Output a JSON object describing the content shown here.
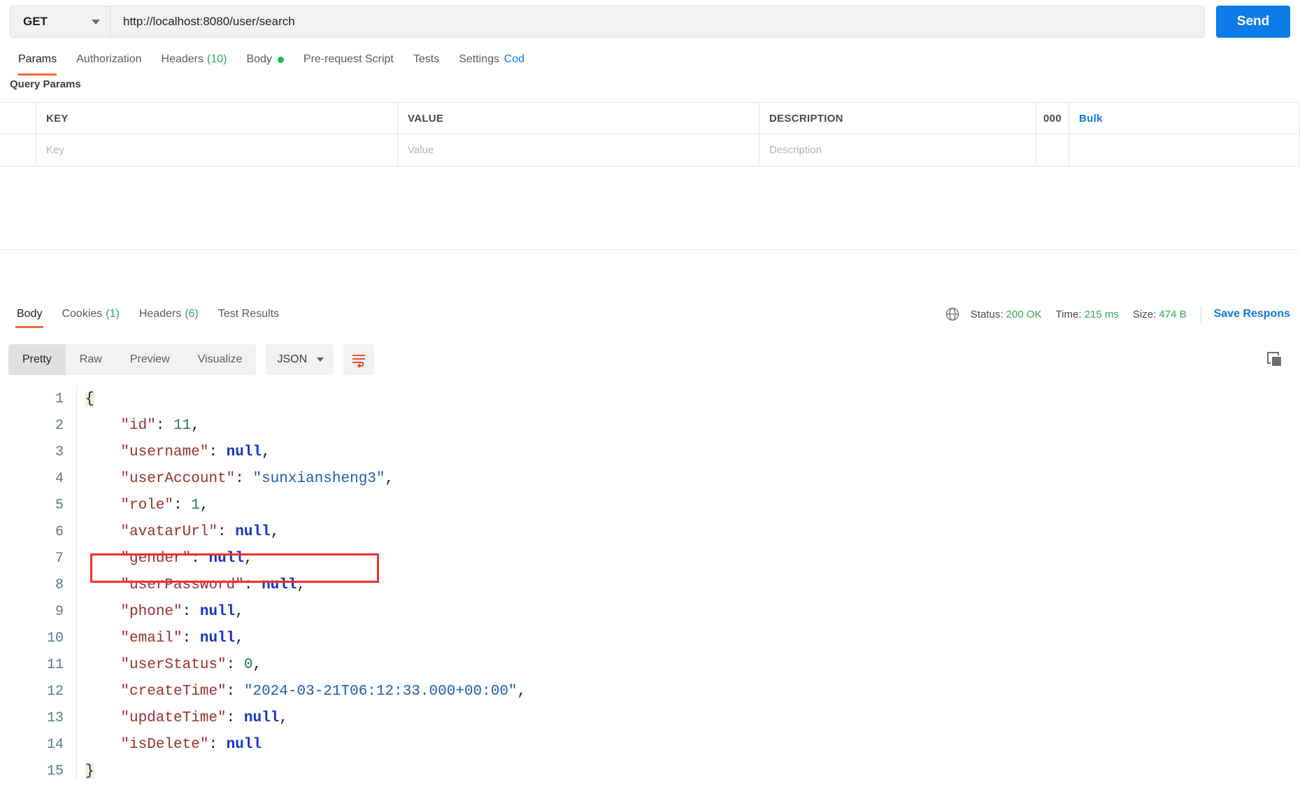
{
  "request": {
    "method": "GET",
    "url": "http://localhost:8080/user/search",
    "send_label": "Send",
    "tabs": [
      {
        "label": "Params",
        "count": "",
        "active": true
      },
      {
        "label": "Authorization",
        "count": "",
        "active": false
      },
      {
        "label": "Headers",
        "count": "(10)",
        "active": false
      },
      {
        "label": "Body",
        "count": "",
        "active": false,
        "dot": true
      },
      {
        "label": "Pre-request Script",
        "count": "",
        "active": false
      },
      {
        "label": "Tests",
        "count": "",
        "active": false
      },
      {
        "label": "Settings",
        "count": "",
        "active": false
      }
    ],
    "code_link": "Cod"
  },
  "params": {
    "section_title": "Query Params",
    "headers": {
      "key": "KEY",
      "value": "VALUE",
      "description": "DESCRIPTION",
      "more": "000",
      "bulk": "Bulk"
    },
    "rows": [
      {
        "key": "Key",
        "value": "Value",
        "description": "Description"
      }
    ]
  },
  "response": {
    "tabs": [
      {
        "label": "Body",
        "count": "",
        "active": true
      },
      {
        "label": "Cookies",
        "count": "(1)",
        "active": false
      },
      {
        "label": "Headers",
        "count": "(6)",
        "active": false
      },
      {
        "label": "Test Results",
        "count": "",
        "active": false
      }
    ],
    "status_label": "Status:",
    "status_value": "200 OK",
    "time_label": "Time:",
    "time_value": "215 ms",
    "size_label": "Size:",
    "size_value": "474 B",
    "save_response": "Save Respons",
    "view_modes": [
      {
        "label": "Pretty",
        "active": true
      },
      {
        "label": "Raw",
        "active": false
      },
      {
        "label": "Preview",
        "active": false
      },
      {
        "label": "Visualize",
        "active": false
      }
    ],
    "format": "JSON"
  },
  "colors": {
    "accent_orange": "#f26b3a",
    "brand_blue": "#0d7ce8",
    "status_green": "#2eab52",
    "highlight_red": "#f03030"
  },
  "body_json": {
    "line_numbers": [
      "1",
      "2",
      "3",
      "4",
      "5",
      "6",
      "7",
      "8",
      "9",
      "10",
      "11",
      "12",
      "13",
      "14",
      "15"
    ],
    "fields": [
      {
        "key": "id",
        "value": "11",
        "type": "number"
      },
      {
        "key": "username",
        "value": "null",
        "type": "null"
      },
      {
        "key": "userAccount",
        "value": "sunxiansheng3",
        "type": "string"
      },
      {
        "key": "role",
        "value": "1",
        "type": "number"
      },
      {
        "key": "avatarUrl",
        "value": "null",
        "type": "null"
      },
      {
        "key": "gender",
        "value": "null",
        "type": "null"
      },
      {
        "key": "userPassword",
        "value": "null",
        "type": "null"
      },
      {
        "key": "phone",
        "value": "null",
        "type": "null"
      },
      {
        "key": "email",
        "value": "null",
        "type": "null"
      },
      {
        "key": "userStatus",
        "value": "0",
        "type": "number"
      },
      {
        "key": "createTime",
        "value": "2024-03-21T06:12:33.000+00:00",
        "type": "string"
      },
      {
        "key": "updateTime",
        "value": "null",
        "type": "null"
      },
      {
        "key": "isDelete",
        "value": "null",
        "type": "null"
      }
    ],
    "open_brace": "{",
    "close_brace": "}",
    "highlighted_field": "userPassword"
  }
}
